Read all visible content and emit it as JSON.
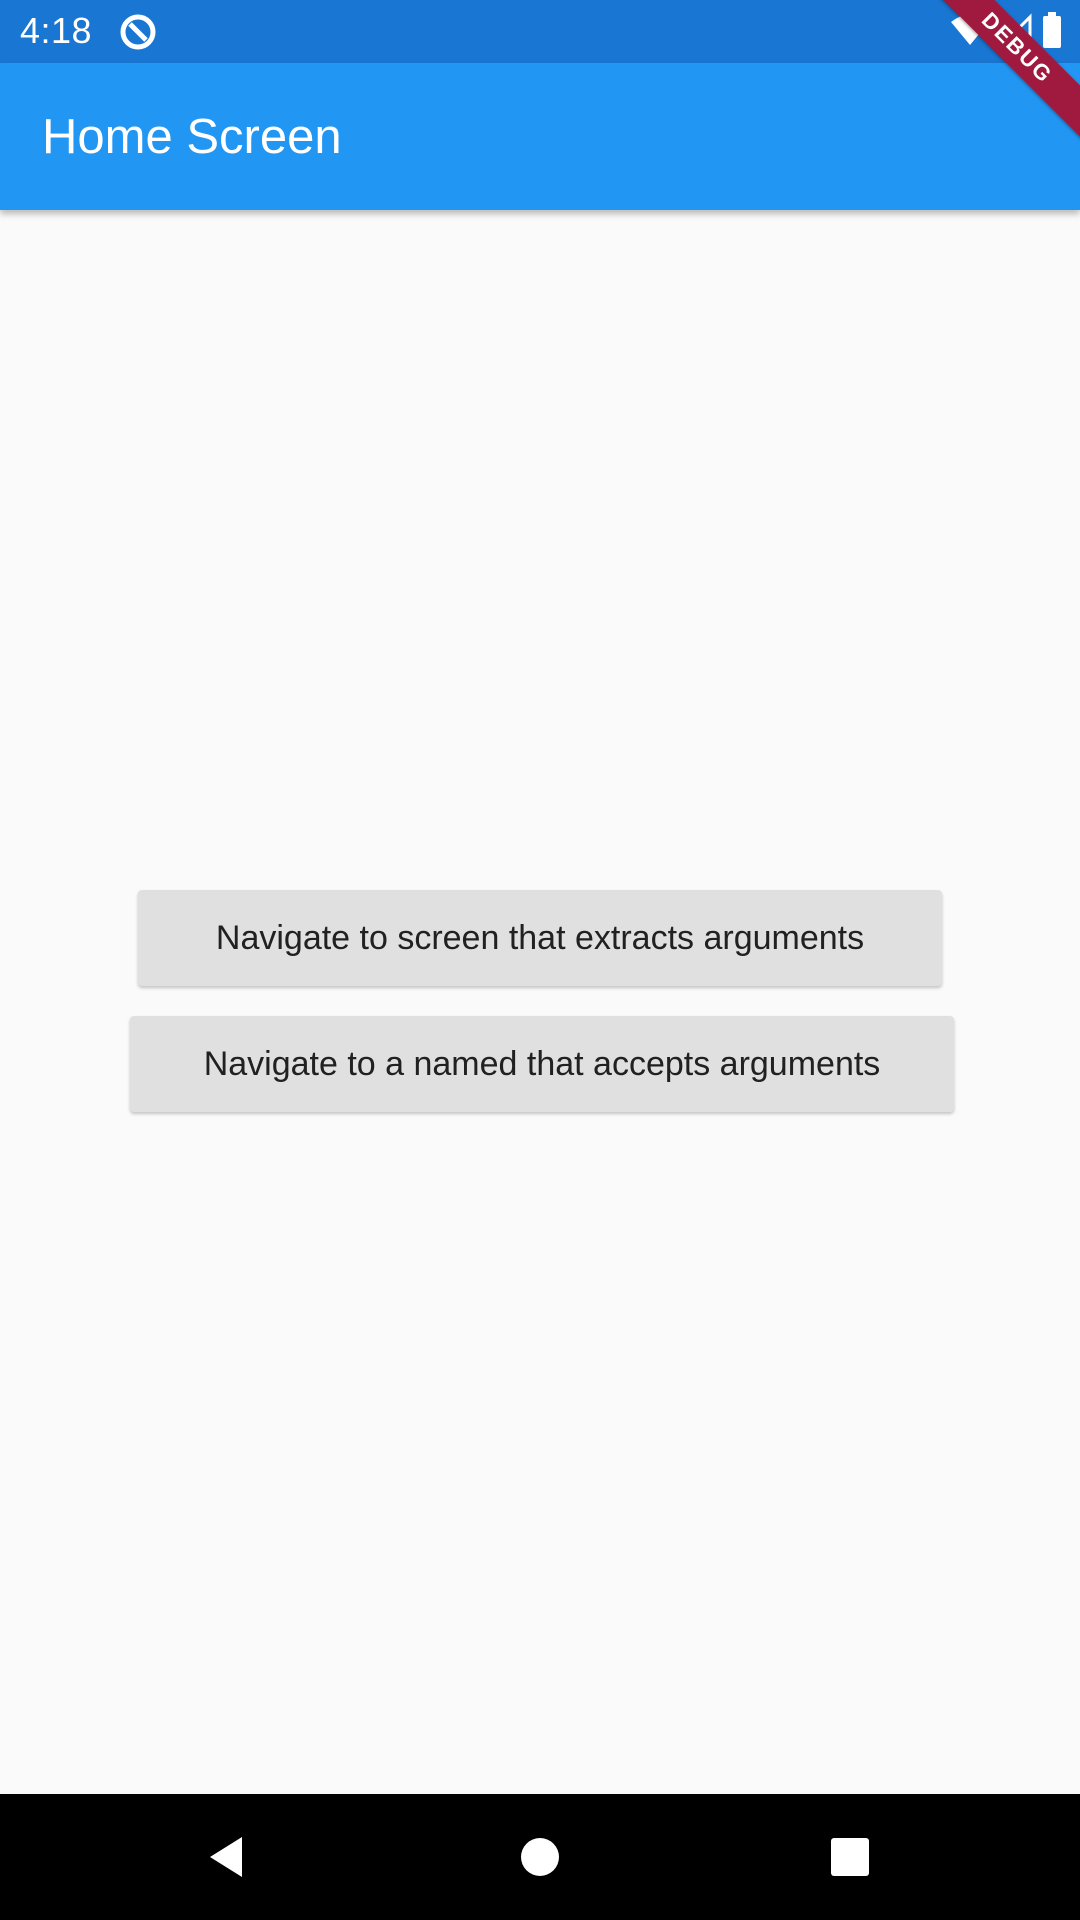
{
  "status_bar": {
    "time": "4:18",
    "icons": [
      "notification-icon",
      "wifi-icon",
      "signal-icon",
      "battery-icon"
    ],
    "background": "#1976d2"
  },
  "app_bar": {
    "title": "Home Screen",
    "background": "#2196f3",
    "debug_banner": "DEBUG"
  },
  "buttons": {
    "extract": "Navigate to screen that extracts arguments",
    "named": "Navigate to a named that accepts arguments"
  },
  "nav_bar": {
    "icons": [
      "back-icon",
      "home-icon",
      "recents-icon"
    ]
  }
}
